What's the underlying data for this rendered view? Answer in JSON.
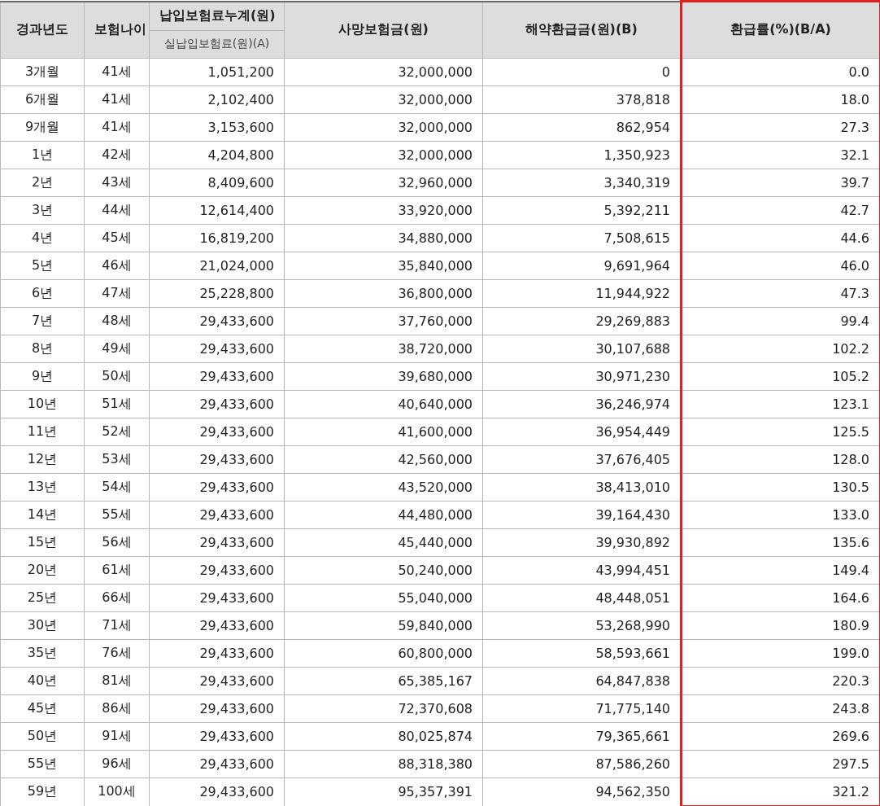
{
  "table": {
    "columns": [
      {
        "label": "경과년도",
        "highlighted": false
      },
      {
        "label": "보험나이",
        "highlighted": false
      },
      {
        "label": "납입보험료누계(원)",
        "sub_label": "실납입보험료(원)(A)",
        "highlighted": false
      },
      {
        "label": "사망보험금(원)",
        "highlighted": false
      },
      {
        "label": "해약환급금(원)(B)",
        "highlighted": false
      },
      {
        "label": "환급률(%)(B/A)",
        "highlighted": true
      }
    ],
    "rows": [
      [
        "3개월",
        "41세",
        "1,051,200",
        "32,000,000",
        "0",
        "0.0"
      ],
      [
        "6개월",
        "41세",
        "2,102,400",
        "32,000,000",
        "378,818",
        "18.0"
      ],
      [
        "9개월",
        "41세",
        "3,153,600",
        "32,000,000",
        "862,954",
        "27.3"
      ],
      [
        "1년",
        "42세",
        "4,204,800",
        "32,000,000",
        "1,350,923",
        "32.1"
      ],
      [
        "2년",
        "43세",
        "8,409,600",
        "32,960,000",
        "3,340,319",
        "39.7"
      ],
      [
        "3년",
        "44세",
        "12,614,400",
        "33,920,000",
        "5,392,211",
        "42.7"
      ],
      [
        "4년",
        "45세",
        "16,819,200",
        "34,880,000",
        "7,508,615",
        "44.6"
      ],
      [
        "5년",
        "46세",
        "21,024,000",
        "35,840,000",
        "9,691,964",
        "46.0"
      ],
      [
        "6년",
        "47세",
        "25,228,800",
        "36,800,000",
        "11,944,922",
        "47.3"
      ],
      [
        "7년",
        "48세",
        "29,433,600",
        "37,760,000",
        "29,269,883",
        "99.4"
      ],
      [
        "8년",
        "49세",
        "29,433,600",
        "38,720,000",
        "30,107,688",
        "102.2"
      ],
      [
        "9년",
        "50세",
        "29,433,600",
        "39,680,000",
        "30,971,230",
        "105.2"
      ],
      [
        "10년",
        "51세",
        "29,433,600",
        "40,640,000",
        "36,246,974",
        "123.1"
      ],
      [
        "11년",
        "52세",
        "29,433,600",
        "41,600,000",
        "36,954,449",
        "125.5"
      ],
      [
        "12년",
        "53세",
        "29,433,600",
        "42,560,000",
        "37,676,405",
        "128.0"
      ],
      [
        "13년",
        "54세",
        "29,433,600",
        "43,520,000",
        "38,413,010",
        "130.5"
      ],
      [
        "14년",
        "55세",
        "29,433,600",
        "44,480,000",
        "39,164,430",
        "133.0"
      ],
      [
        "15년",
        "56세",
        "29,433,600",
        "45,440,000",
        "39,930,892",
        "135.6"
      ],
      [
        "20년",
        "61세",
        "29,433,600",
        "50,240,000",
        "43,994,451",
        "149.4"
      ],
      [
        "25년",
        "66세",
        "29,433,600",
        "55,040,000",
        "48,448,051",
        "164.6"
      ],
      [
        "30년",
        "71세",
        "29,433,600",
        "59,840,000",
        "53,268,990",
        "180.9"
      ],
      [
        "35년",
        "76세",
        "29,433,600",
        "60,800,000",
        "58,593,661",
        "199.0"
      ],
      [
        "40년",
        "81세",
        "29,433,600",
        "65,385,167",
        "64,847,838",
        "220.3"
      ],
      [
        "45년",
        "86세",
        "29,433,600",
        "72,370,608",
        "71,775,140",
        "243.8"
      ],
      [
        "50년",
        "91세",
        "29,433,600",
        "80,025,874",
        "79,365,661",
        "269.6"
      ],
      [
        "55년",
        "96세",
        "29,433,600",
        "88,318,380",
        "87,586,260",
        "297.5"
      ],
      [
        "59년",
        "100세",
        "29,433,600",
        "95,357,391",
        "94,562,350",
        "321.2"
      ]
    ]
  }
}
